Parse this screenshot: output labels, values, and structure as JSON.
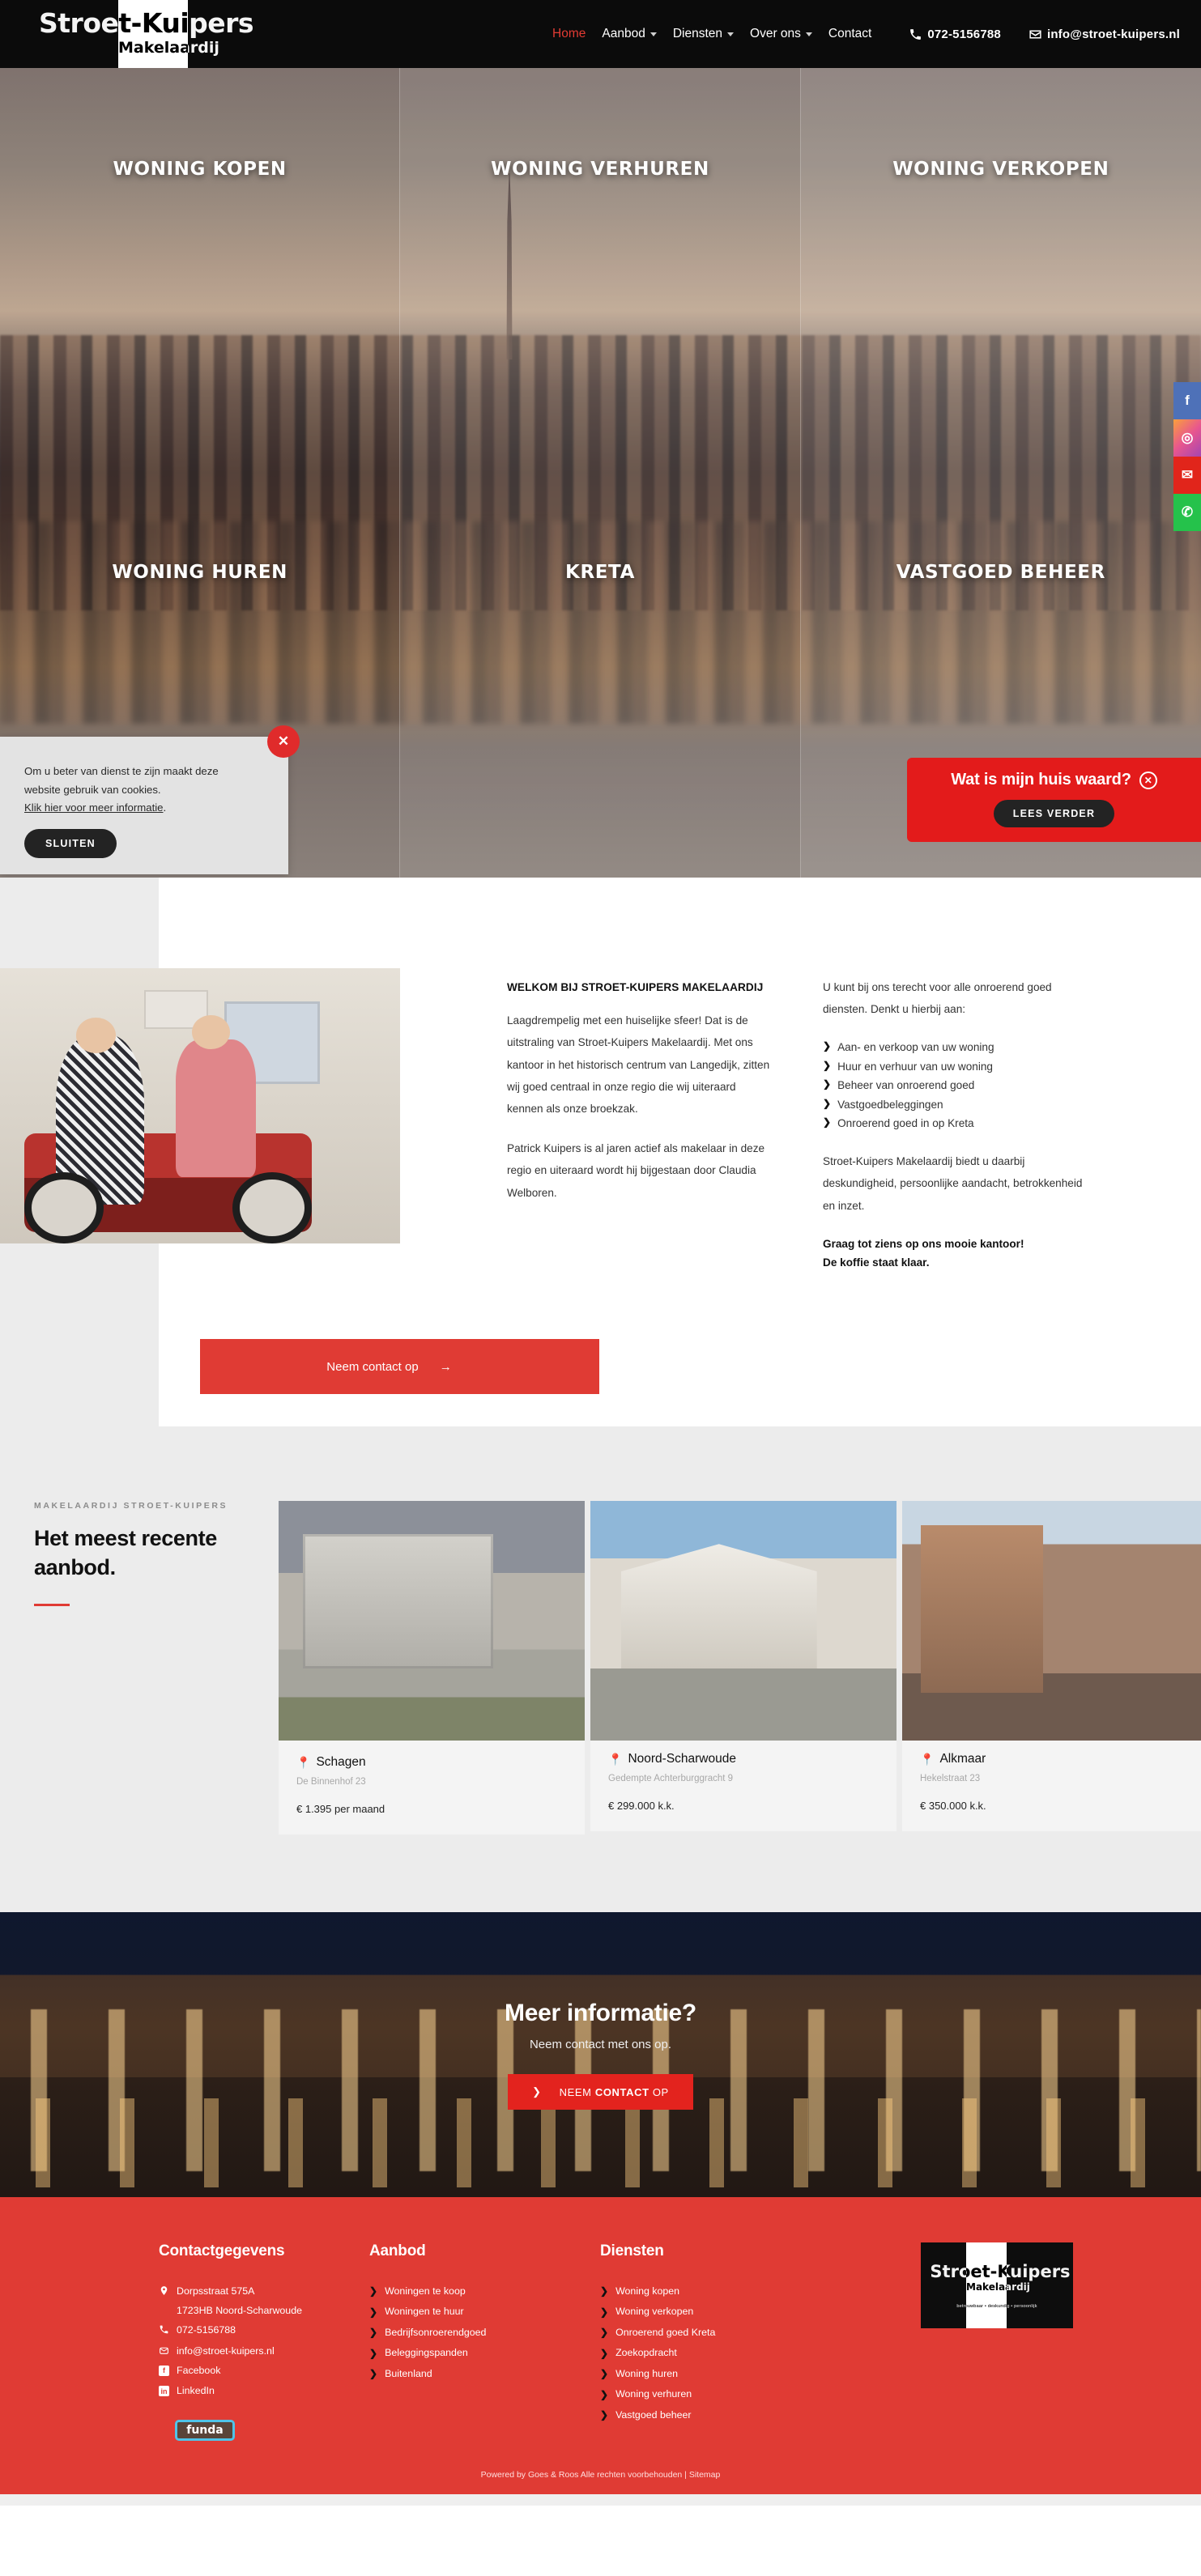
{
  "header": {
    "logo_main": "Stroet-Kuipers",
    "logo_sub": "Makelaardij",
    "nav": [
      {
        "label": "Home",
        "active": true,
        "caret": false
      },
      {
        "label": "Aanbod",
        "active": false,
        "caret": true
      },
      {
        "label": "Diensten",
        "active": false,
        "caret": true
      },
      {
        "label": "Over ons",
        "active": false,
        "caret": true
      },
      {
        "label": "Contact",
        "active": false,
        "caret": false
      }
    ],
    "phone": "072-5156788",
    "email": "info@stroet-kuipers.nl",
    "phone_icon": "phone-icon",
    "email_icon": "envelope-icon"
  },
  "hero": {
    "tiles": [
      {
        "label": "WONING KOPEN"
      },
      {
        "label": "WONING VERHUREN"
      },
      {
        "label": "WONING VERKOPEN"
      },
      {
        "label": "WONING HUREN"
      },
      {
        "label": "KRETA"
      },
      {
        "label": "VASTGOED BEHEER"
      }
    ]
  },
  "social_rail": [
    {
      "name": "facebook-icon",
      "glyph": "f",
      "color": "#4e71b8"
    },
    {
      "name": "instagram-icon",
      "glyph": "◎",
      "color": "#e8568e"
    },
    {
      "name": "email-icon",
      "glyph": "✉",
      "color": "#e1251b"
    },
    {
      "name": "whatsapp-icon",
      "glyph": "✆",
      "color": "#25c24b"
    }
  ],
  "cookie": {
    "line1": "Om u beter van dienst te zijn maakt deze",
    "line2": "website gebruik van cookies.",
    "link": "Klik hier voor meer informatie",
    "link_tail": ".",
    "button": "SLUITEN",
    "close_glyph": "✕"
  },
  "huis_popup": {
    "title": "Wat is mijn huis waard?",
    "button": "LEES VERDER",
    "close_glyph": "✕"
  },
  "about": {
    "heading": "WELKOM BIJ STROET-KUIPERS MAKELAARDIJ",
    "para1": "Laagdrempelig met een huiselijke sfeer! Dat is de uitstraling van Stroet-Kuipers Makelaardij. Met ons kantoor in het historisch centrum van Langedijk, zitten wij goed centraal in onze regio die wij uiteraard kennen als onze broekzak.",
    "para2": "Patrick Kuipers is al jaren actief als makelaar in deze regio en uiteraard wordt hij bijgestaan door Claudia Welboren.",
    "right_intro": "U kunt bij ons terecht voor alle onroerend goed diensten. Denkt u hierbij aan:",
    "services": [
      "Aan- en verkoop van uw woning",
      "Huur en verhuur van uw woning",
      "Beheer van onroerend goed",
      "Vastgoedbeleggingen",
      "Onroerend goed in op Kreta"
    ],
    "right_para": "Stroet-Kuipers Makelaardij biedt u daarbij deskundigheid, persoonlijke aandacht, betrokkenheid en inzet.",
    "strong1": "Graag tot ziens op ons mooie kantoor!",
    "strong2": "De koffie staat klaar.",
    "cta_button": "Neem contact op",
    "cta_arrow": "→"
  },
  "listings": {
    "kicker": "MAKELAARDIJ STROET-KUIPERS",
    "title_l1": "Het meest recente",
    "title_l2": "aanbod.",
    "cards": [
      {
        "city": "Schagen",
        "address": "De Binnenhof 23",
        "price": "€ 1.395 per maand"
      },
      {
        "city": "Noord-Scharwoude",
        "address": "Gedempte Achterburggracht 9",
        "price": "€ 299.000 k.k."
      },
      {
        "city": "Alkmaar",
        "address": "Hekelstraat 23",
        "price": "€ 350.000 k.k."
      }
    ]
  },
  "cta_banner": {
    "title": "Meer informatie?",
    "subtitle": "Neem contact met ons op.",
    "button_pre": "NEEM ",
    "button_bold": "CONTACT",
    "button_post": " OP",
    "button_arrow": "❯"
  },
  "footer": {
    "contact": {
      "heading": "Contactgegevens",
      "address1": "Dorpsstraat 575A",
      "address2": "1723HB Noord-Scharwoude",
      "phone": "072-5156788",
      "email": "info@stroet-kuipers.nl",
      "facebook": "Facebook",
      "linkedin": "LinkedIn",
      "funda": "funda"
    },
    "aanbod": {
      "heading": "Aanbod",
      "links": [
        "Woningen te koop",
        "Woningen te huur",
        "Bedrijfsonroerendgoed",
        "Beleggingspanden",
        "Buitenland"
      ]
    },
    "diensten": {
      "heading": "Diensten",
      "links": [
        "Woning kopen",
        "Woning verkopen",
        "Onroerend goed Kreta",
        "Zoekopdracht",
        "Woning huren",
        "Woning verhuren",
        "Vastgoed beheer"
      ]
    },
    "logo_main": "Stroet-Kuipers",
    "logo_sub": "Makelaardij",
    "logo_tag": "betrouwbaar • deskundig • persoonlijk",
    "copyright": "Powered by Goes & Roos Alle rechten voorbehouden |",
    "sitemap": "Sitemap"
  },
  "colors": {
    "brand_red": "#e03b34",
    "popup_red": "#e31b1b",
    "dark": "#0b0b0b"
  }
}
